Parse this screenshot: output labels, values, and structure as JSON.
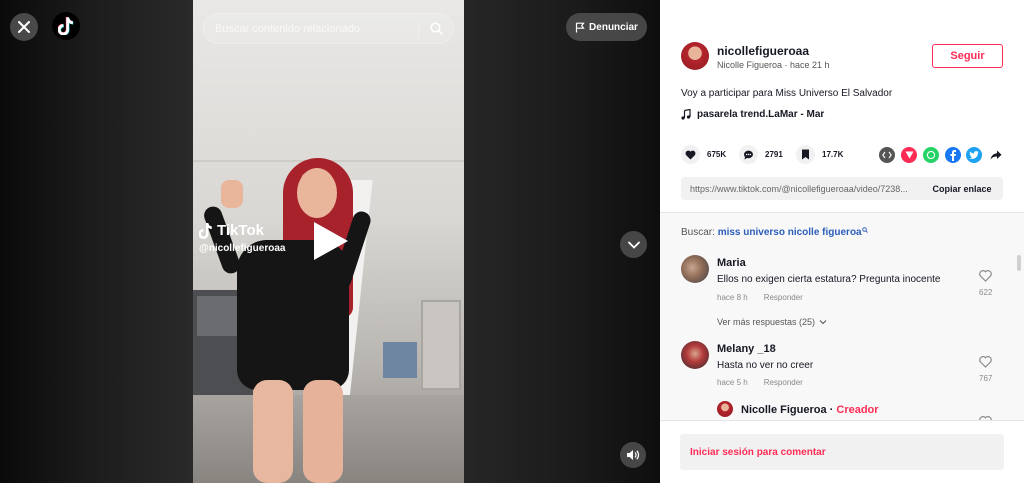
{
  "top": {
    "search_placeholder": "Buscar contenido relacionado",
    "report_label": "Denunciar"
  },
  "video": {
    "watermark_brand": "TikTok",
    "watermark_user": "@nicollefigueroaa"
  },
  "author": {
    "handle": "nicollefigueroaa",
    "meta": "Nicolle Figueroa · hace 21 h",
    "follow_label": "Seguir"
  },
  "post": {
    "caption": "Voy a participar para Miss Universo El Salvador",
    "music": "pasarela trend.LaMar - Mar"
  },
  "stats": {
    "likes": "675K",
    "comments": "2791",
    "saves": "17.7K"
  },
  "share": {
    "link": "https://www.tiktok.com/@nicollefigueroaa/video/7238...",
    "copy_label": "Copiar enlace",
    "icons": [
      "embed-icon",
      "send-icon",
      "whatsapp-icon",
      "facebook-icon",
      "twitter-icon",
      "share-arrow-icon"
    ]
  },
  "related": {
    "label": "Buscar:",
    "query": "miss universo nicolle figueroa"
  },
  "comments": [
    {
      "user": "Maria",
      "text": "Ellos no exigen cierta estatura? Pregunta inocente",
      "time": "hace 8 h",
      "reply_label": "Responder",
      "likes": "622"
    },
    {
      "user": "Melany _18",
      "text": "Hasta no ver no creer",
      "time": "hace 5 h",
      "reply_label": "Responder",
      "likes": "767"
    }
  ],
  "more_replies": "Ver más respuestas (25)",
  "reply": {
    "user": "Nicolle Figueroa",
    "separator": "·",
    "tag": "Creador"
  },
  "login": {
    "label": "Iniciar sesión para comentar"
  },
  "colors": {
    "accent": "#fe2c55",
    "link": "#2b5db9"
  }
}
